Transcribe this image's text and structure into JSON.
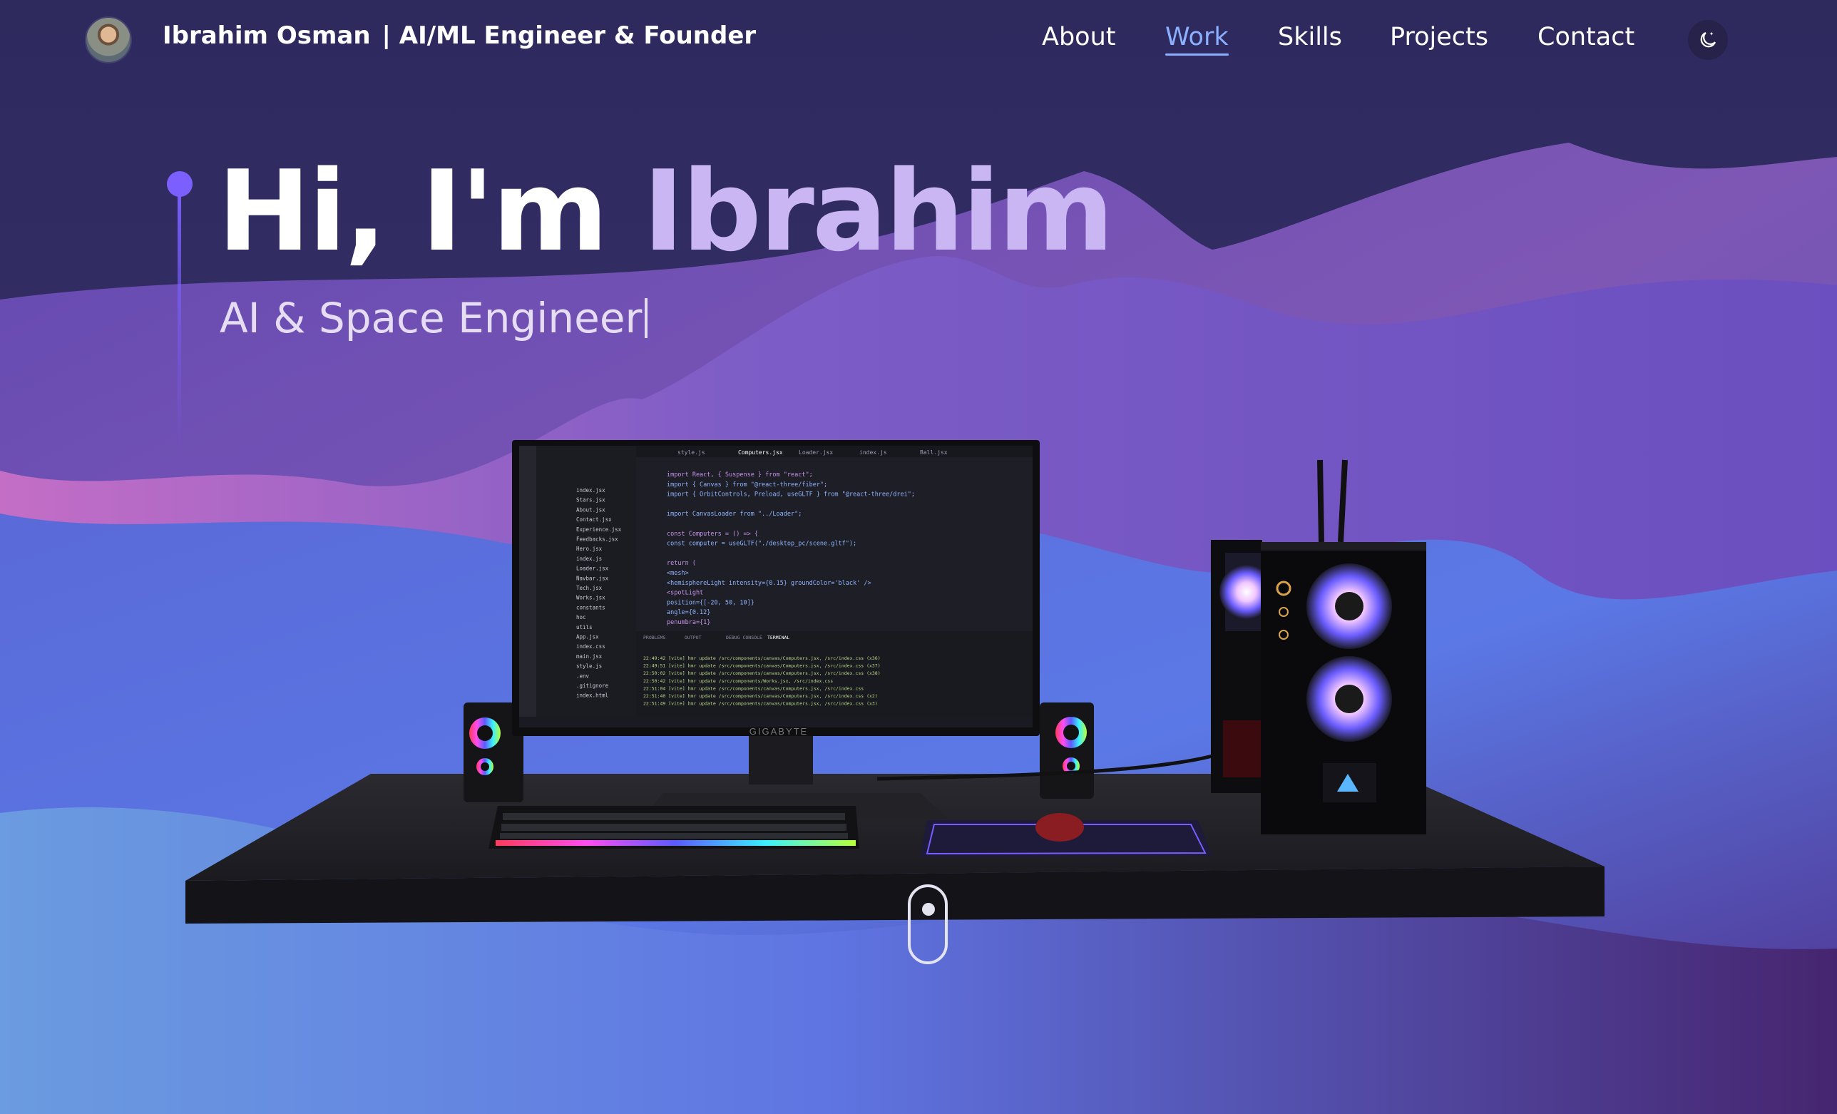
{
  "header": {
    "name": "Ibrahim Osman",
    "role": "| AI/ML Engineer & Founder",
    "nav": [
      {
        "label": "About",
        "active": false
      },
      {
        "label": "Work",
        "active": true
      },
      {
        "label": "Skills",
        "active": false
      },
      {
        "label": "Projects",
        "active": false
      },
      {
        "label": "Contact",
        "active": false
      }
    ],
    "theme_icon": "moon-stars-icon"
  },
  "hero": {
    "greeting": "Hi, I'm",
    "name": "Ibrahim",
    "subtitle": "AI & Space Engineer"
  },
  "monitor": {
    "brand": "GIGABYTE",
    "tabs": [
      "style.js",
      "Computers.jsx",
      "Loader.jsx",
      "index.js",
      "Ball.jsx"
    ],
    "code": [
      "import React, { Suspense } from \"react\";",
      "import { Canvas } from \"@react-three/fiber\";",
      "import { OrbitControls, Preload, useGLTF } from \"@react-three/drei\";",
      "",
      "import CanvasLoader from \"../Loader\";",
      "",
      "const Computers = () => {",
      "  const computer = useGLTF(\"./desktop_pc/scene.gltf\");",
      "",
      "  return (",
      "    <mesh>",
      "      <hemisphereLight intensity={0.15} groundColor='black' />",
      "      <spotLight",
      "        position={[-20, 50, 10]}",
      "        angle={0.12}",
      "        penumbra={1}"
    ],
    "files": [
      "index.jsx",
      "Stars.jsx",
      "About.jsx",
      "Contact.jsx",
      "Experience.jsx",
      "Feedbacks.jsx",
      "Hero.jsx",
      "index.js",
      "Loader.jsx",
      "Navbar.jsx",
      "Tech.jsx",
      "Works.jsx",
      "constants",
      "hoc",
      "utils",
      "App.jsx",
      "index.css",
      "main.jsx",
      "style.js",
      ".env",
      ".gitignore",
      "index.html"
    ],
    "terminal": [
      "22:49:42 [vite] hmr update /src/components/canvas/Computers.jsx, /src/index.css (x36)",
      "22:49:51 [vite] hmr update /src/components/canvas/Computers.jsx, /src/index.css (x37)",
      "22:50:02 [vite] hmr update /src/components/canvas/Computers.jsx, /src/index.css (x38)",
      "22:50:42 [vite] hmr update /src/components/Works.jsx, /src/index.css",
      "22:51:04 [vite] hmr update /src/components/canvas/Computers.jsx, /src/index.css",
      "22:51:40 [vite] hmr update /src/components/canvas/Computers.jsx, /src/index.css (x2)",
      "22:51:49 [vite] hmr update /src/components/canvas/Computers.jsx, /src/index.css (x3)"
    ],
    "panel_tabs": [
      "PROBLEMS",
      "OUTPUT",
      "DEBUG CONSOLE",
      "TERMINAL"
    ]
  },
  "colors": {
    "accent": "#7b60ff",
    "nav_active": "#8ab0ff",
    "name_highlight": "#c9b6f2"
  }
}
